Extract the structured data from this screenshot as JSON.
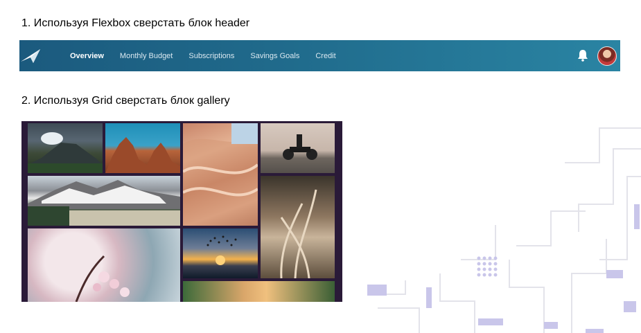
{
  "tasks": [
    {
      "number": "1.",
      "lead": "Используя",
      "tech": "Flexbox",
      "action": "сверстать блок",
      "target": "header"
    },
    {
      "number": "2.",
      "lead": "Используя",
      "tech": "Grid",
      "action": "сверстать блок",
      "target": "gallery"
    }
  ],
  "header": {
    "nav": [
      {
        "label": "Overview",
        "active": true
      },
      {
        "label": "Monthly Budget",
        "active": false
      },
      {
        "label": "Subscriptions",
        "active": false
      },
      {
        "label": "Savings Goals",
        "active": false
      },
      {
        "label": "Credit",
        "active": false
      }
    ],
    "icons": {
      "logo": "paper-plane-logo",
      "notifications": "bell-icon",
      "avatar": "user-avatar"
    },
    "colors": {
      "gradient_start": "#1b5a7e",
      "gradient_end": "#2a84a3"
    }
  },
  "gallery": {
    "tiles": [
      {
        "subject": "volcano landscape"
      },
      {
        "subject": "red rock spires"
      },
      {
        "subject": "sandstone canyon"
      },
      {
        "subject": "motorcyclist"
      },
      {
        "subject": "mountain lake"
      },
      {
        "subject": "dry grass"
      },
      {
        "subject": "cherry blossoms"
      },
      {
        "subject": "birds at sunset"
      },
      {
        "subject": "valley sunrise"
      }
    ],
    "colors": {
      "background": "#2a1a38"
    }
  }
}
